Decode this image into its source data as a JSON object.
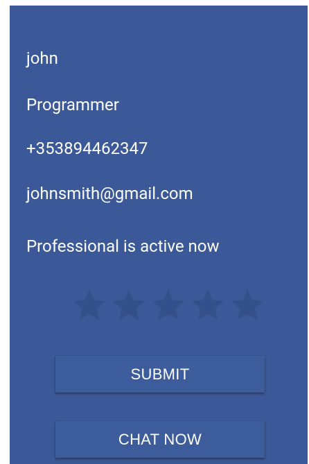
{
  "profile": {
    "name": "john",
    "role": "Programmer",
    "phone": "+353894462347",
    "email": "johnsmith@gmail.com",
    "status": "Professional is active now"
  },
  "rating": {
    "max_stars": 5,
    "selected": 0,
    "icon": "star-icon"
  },
  "buttons": {
    "submit": "SUBMIT",
    "chat": "CHAT NOW"
  },
  "colors": {
    "background": "#3B5998",
    "text": "#FFFFFF",
    "star_empty": "#34508A",
    "button": "#3D5C9B"
  }
}
